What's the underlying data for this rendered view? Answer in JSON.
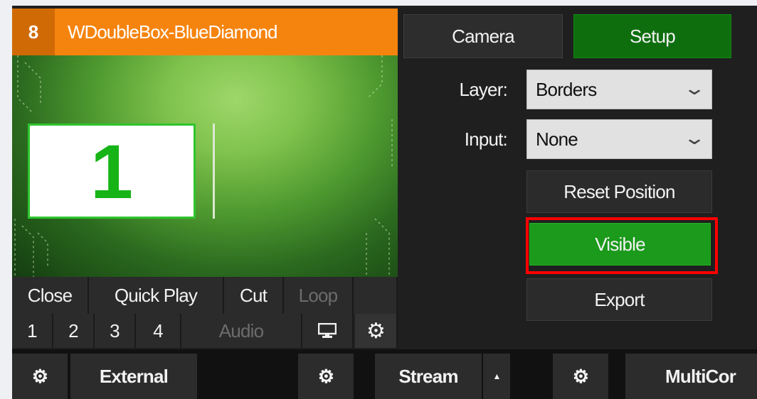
{
  "input": {
    "number": "8",
    "title": "WDoubleBox-BlueDiamond",
    "preview_number": "1"
  },
  "controls": {
    "row1": [
      "Close",
      "Quick Play",
      "Cut",
      "Loop"
    ],
    "row2": [
      "1",
      "2",
      "3",
      "4",
      "Audio"
    ],
    "monitor_icon": "monitor-icon",
    "settings_icon": "gear-icon"
  },
  "panel": {
    "tabs": [
      "Camera",
      "Setup"
    ],
    "layer_label": "Layer:",
    "layer_value": "Borders",
    "input_label": "Input:",
    "input_value": "None",
    "reset_label": "Reset Position",
    "visible_label": "Visible",
    "export_label": "Export",
    "highlight_color": "#ff0000",
    "accent_green": "#1b9a1b",
    "header_orange": "#f5840f"
  },
  "bottom_bar": {
    "external_label": "External",
    "stream_label": "Stream",
    "stream_arrow": "▲",
    "multicorder_label": "MultiCor"
  }
}
